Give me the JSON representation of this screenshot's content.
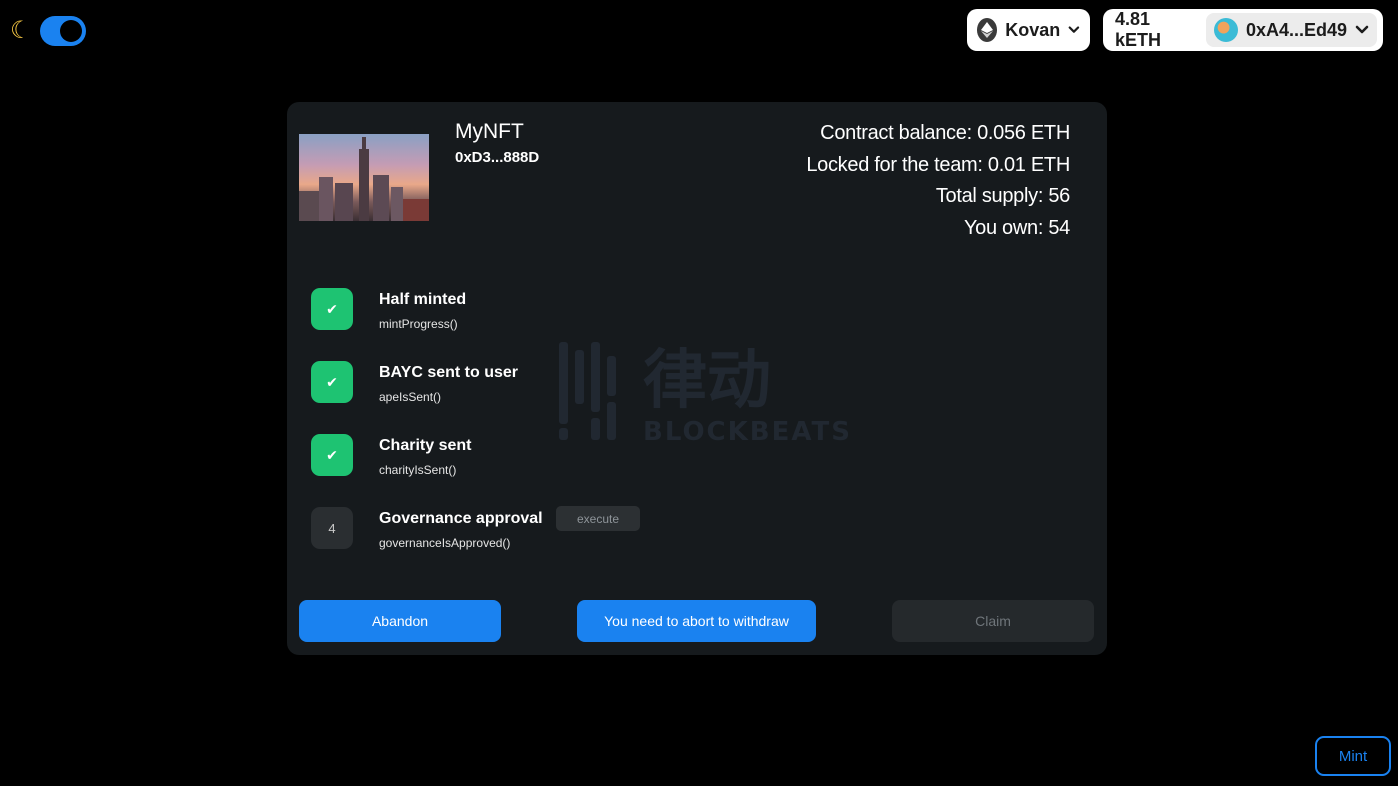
{
  "header": {
    "theme_icon": "moon-icon",
    "network": {
      "label": "Kovan",
      "icon": "ethereum-icon"
    },
    "wallet": {
      "balance": "4.81 kETH",
      "address": "0xA4...Ed49"
    }
  },
  "nft": {
    "name": "MyNFT",
    "address": "0xD3...888D"
  },
  "stats": [
    "Contract balance: 0.056 ETH",
    "Locked for the team: 0.01 ETH",
    "Total supply: 56",
    "You own: 54"
  ],
  "steps": [
    {
      "badge": "✔",
      "title": "Half minted",
      "fn": "mintProgress()",
      "status": "done"
    },
    {
      "badge": "✔",
      "title": "BAYC sent to user",
      "fn": "apeIsSent()",
      "status": "done"
    },
    {
      "badge": "✔",
      "title": "Charity sent",
      "fn": "charityIsSent()",
      "status": "done"
    },
    {
      "badge": "4",
      "title": "Governance approval",
      "fn": "governanceIsApproved()",
      "status": "pending",
      "action": "execute"
    }
  ],
  "buttons": {
    "abandon": "Abandon",
    "abort": "You need to abort to withdraw",
    "claim": "Claim"
  },
  "mint_label": "Mint",
  "watermark": {
    "cjk": "律动",
    "latin": "BLOCKBEATS"
  },
  "colors": {
    "accent": "#1a82f0",
    "success": "#1ec372",
    "card": "#161a1d",
    "background": "#000000"
  }
}
